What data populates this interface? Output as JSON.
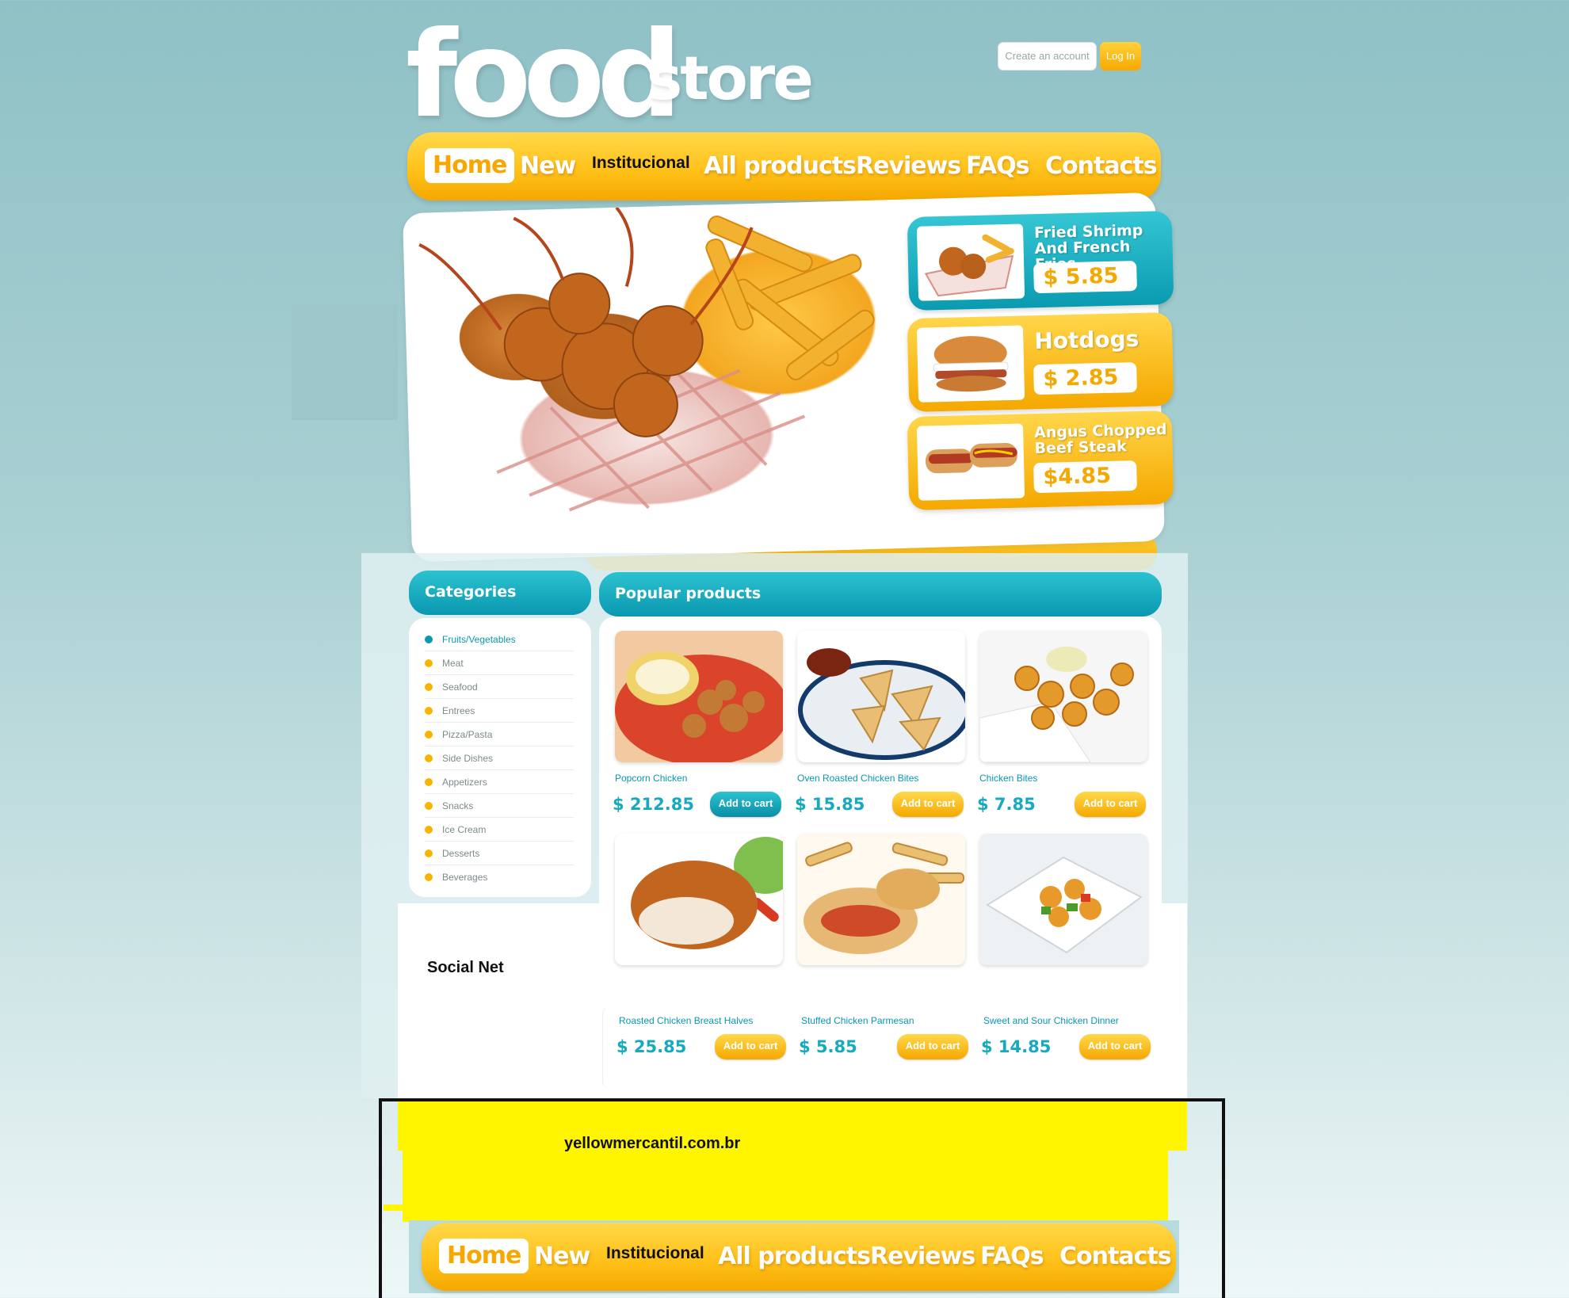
{
  "brand": {
    "logo_main": "food",
    "logo_sub": "store"
  },
  "account": {
    "create_label": "Create an account",
    "login_label": "Log In"
  },
  "nav": {
    "items": [
      {
        "label": "Home"
      },
      {
        "label": "New"
      },
      {
        "label": "Institucional"
      },
      {
        "label": "All products"
      },
      {
        "label": "Reviews"
      },
      {
        "label": "FAQs"
      },
      {
        "label": "Contacts"
      }
    ]
  },
  "featured": [
    {
      "title": "Fried Shrimp And French Fries",
      "price": "$ 5.85"
    },
    {
      "title": "Hotdogs",
      "price": "$ 2.85"
    },
    {
      "title": "Angus Chopped Beef Steak",
      "price": "$4.85"
    }
  ],
  "categories": {
    "heading": "Categories",
    "items": [
      "Fruits/Vegetables",
      "Meat",
      "Seafood",
      "Entrees",
      "Pizza/Pasta",
      "Side Dishes",
      "Appetizers",
      "Snacks",
      "Ice Cream",
      "Desserts",
      "Beverages"
    ]
  },
  "social": {
    "heading": "Social Net"
  },
  "popular": {
    "heading": "Popular products",
    "cart_label": "Add to cart",
    "products": [
      {
        "name": "Popcorn Chicken",
        "price": "$ 212.85"
      },
      {
        "name": "Oven Roasted Chicken Bites",
        "price": "$ 15.85"
      },
      {
        "name": "Chicken Bites",
        "price": "$ 7.85"
      },
      {
        "name": "Roasted Chicken Breast Halves",
        "price": "$ 25.85"
      },
      {
        "name": "Stuffed Chicken Parmesan",
        "price": "$ 5.85"
      },
      {
        "name": "Sweet and Sour Chicken Dinner",
        "price": "$ 14.85"
      }
    ]
  },
  "footer": {
    "url": "yellowmercantil.com.br"
  },
  "colors": {
    "teal": "#0a98b0",
    "gold": "#f5a800",
    "background": "#a9d0d3",
    "footer_yellow": "#fff500"
  }
}
